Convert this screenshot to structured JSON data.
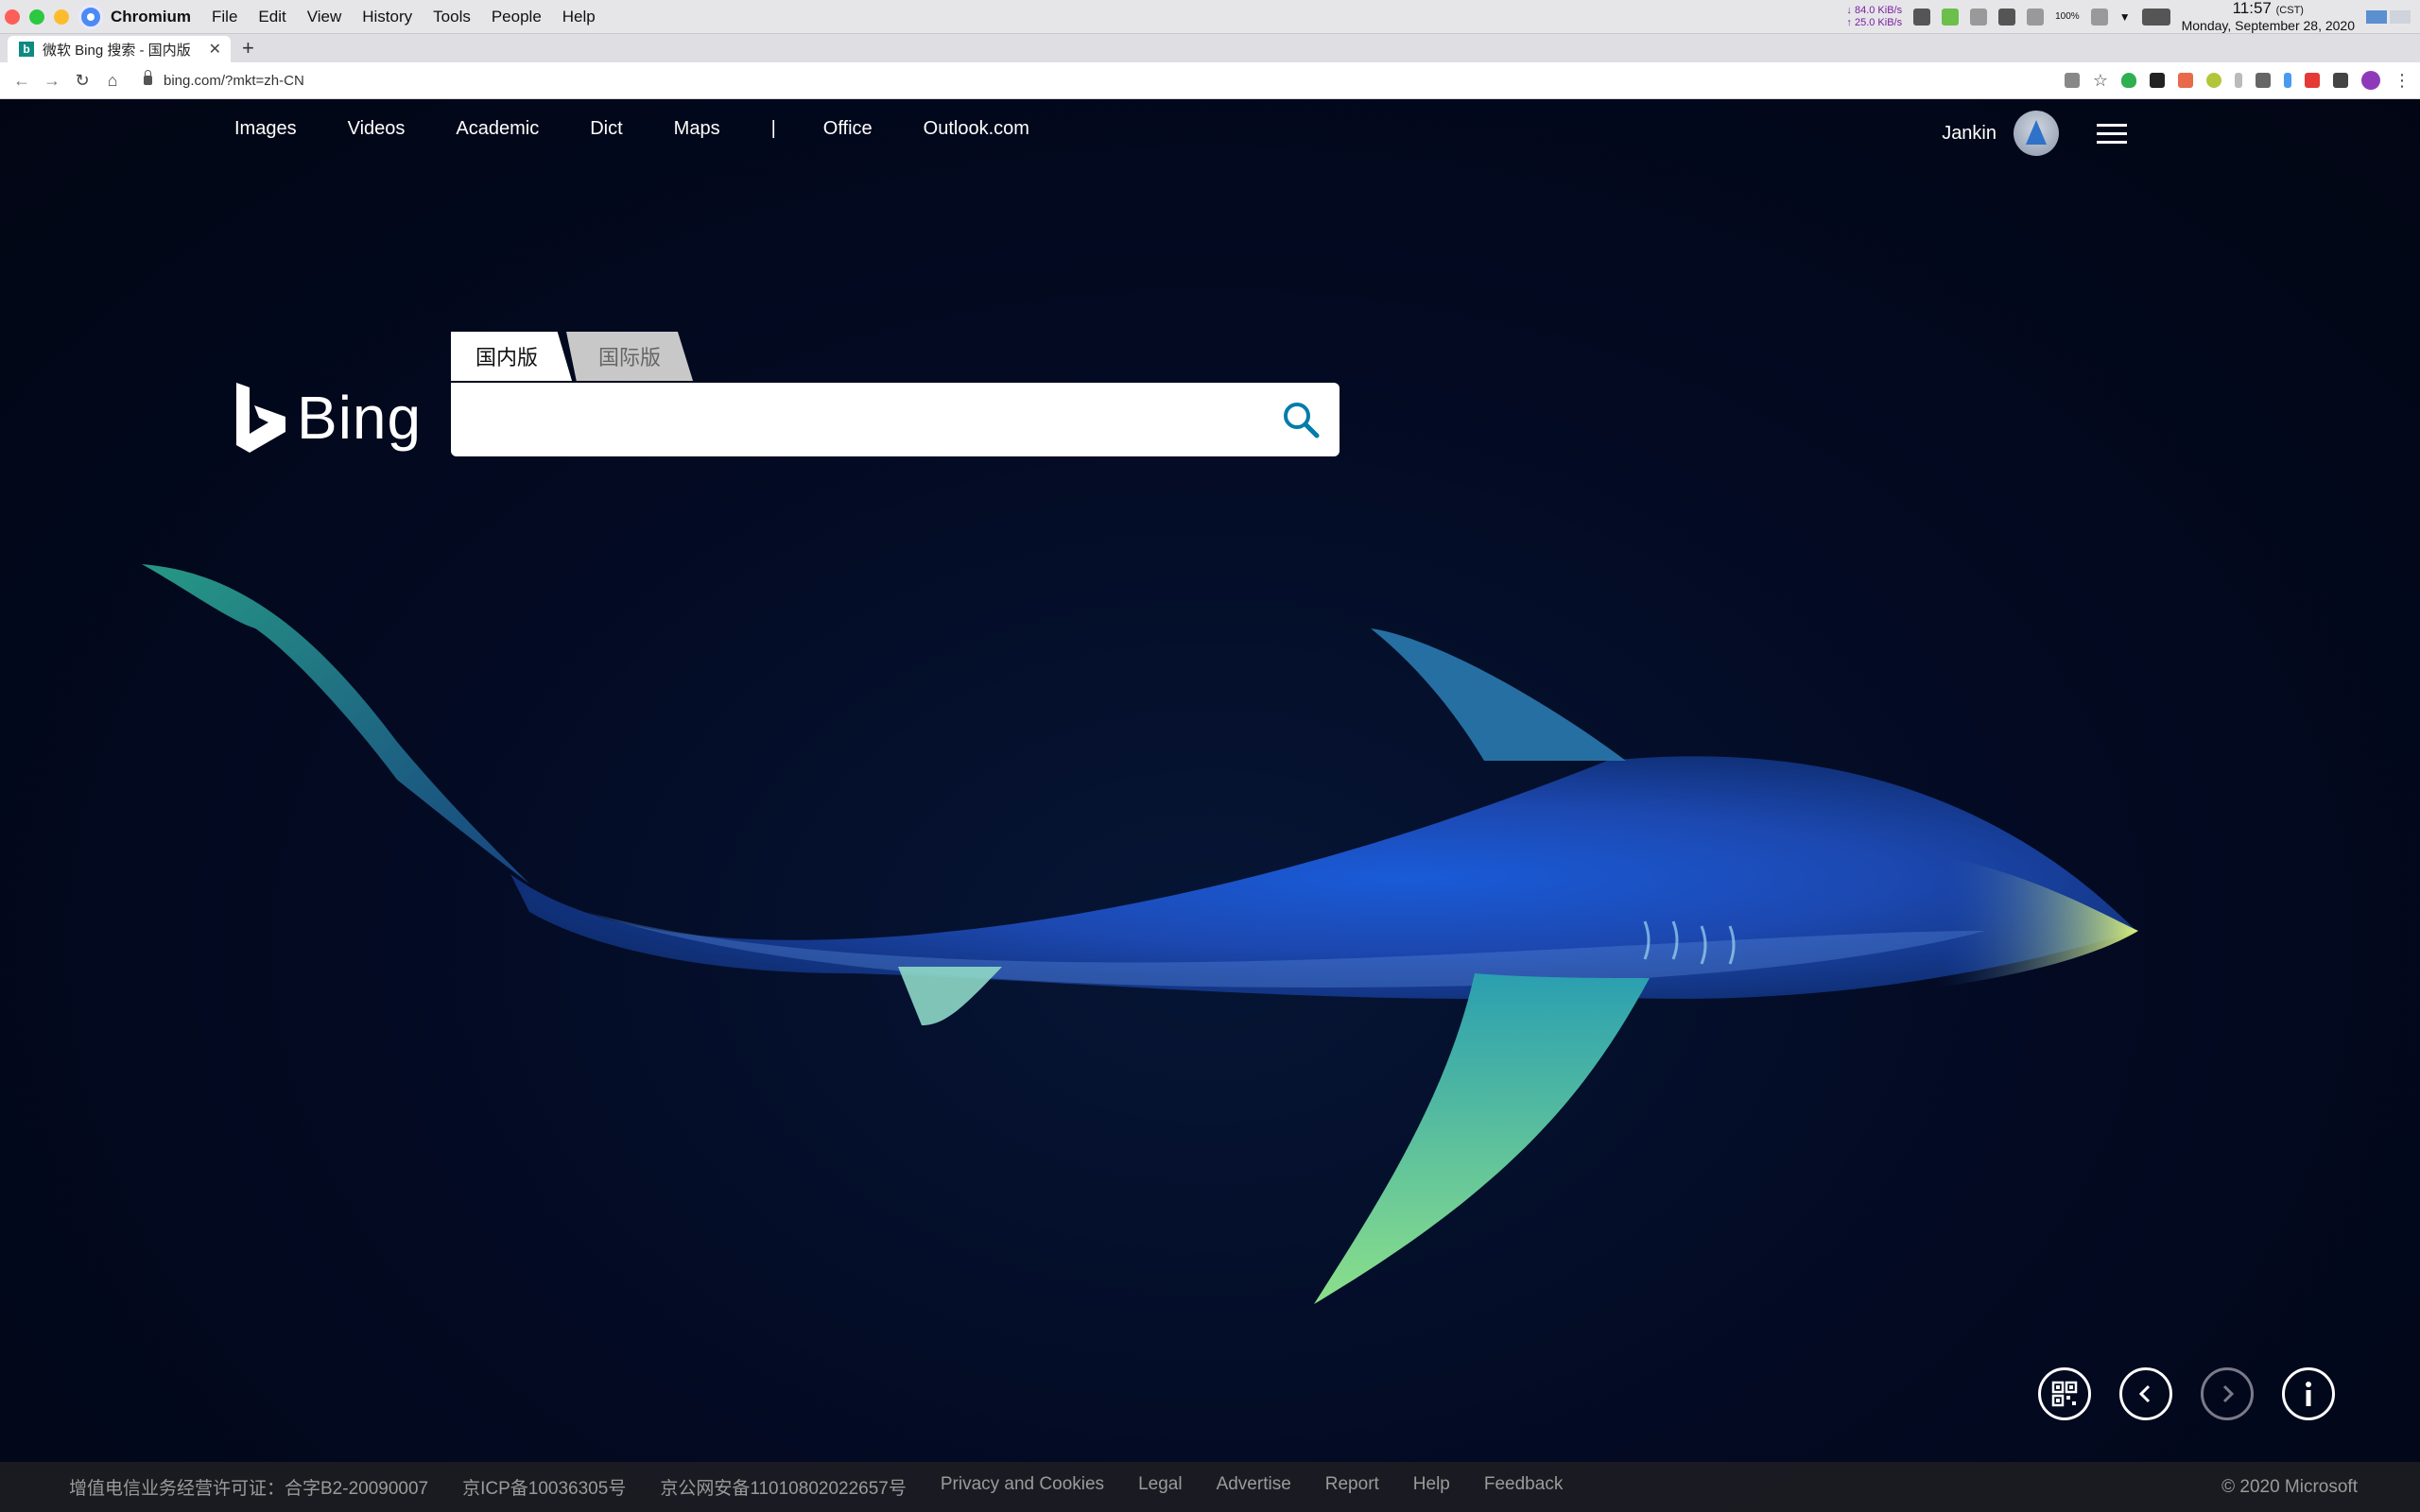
{
  "os_menubar": {
    "app_name": "Chromium",
    "menus": [
      "File",
      "Edit",
      "View",
      "History",
      "Tools",
      "People",
      "Help"
    ],
    "net_down": "84.0 KiB/s",
    "net_up": "25.0 KiB/s",
    "battery": "100%",
    "time": "11:57",
    "timezone": "(CST)",
    "date": "Monday, September 28, 2020"
  },
  "browser": {
    "tab_title": "微软 Bing 搜索 - 国内版",
    "tab_favicon": "b",
    "new_tab_label": "+",
    "url": "bing.com/?mkt=zh-CN"
  },
  "bing": {
    "nav": [
      "Images",
      "Videos",
      "Academic",
      "Dict",
      "Maps"
    ],
    "nav_separator": "|",
    "nav_extra": [
      "Office",
      "Outlook.com"
    ],
    "user_name": "Jankin",
    "logo_text": "Bing",
    "search_tabs": [
      "国内版",
      "国际版"
    ],
    "active_tab": "国内版",
    "search": {
      "value": "",
      "placeholder": ""
    },
    "footer_items": [
      "增值电信业务经营许可证：合字B2-20090007",
      "京ICP备10036305号",
      "京公网安备11010802022657号",
      "Privacy and Cookies",
      "Legal",
      "Advertise",
      "Report",
      "Help",
      "Feedback"
    ],
    "copyright": "© 2020 Microsoft",
    "controls": [
      "qr-code-icon",
      "previous-image-icon",
      "next-image-icon",
      "info-icon"
    ],
    "accent_color": "#007daa"
  }
}
